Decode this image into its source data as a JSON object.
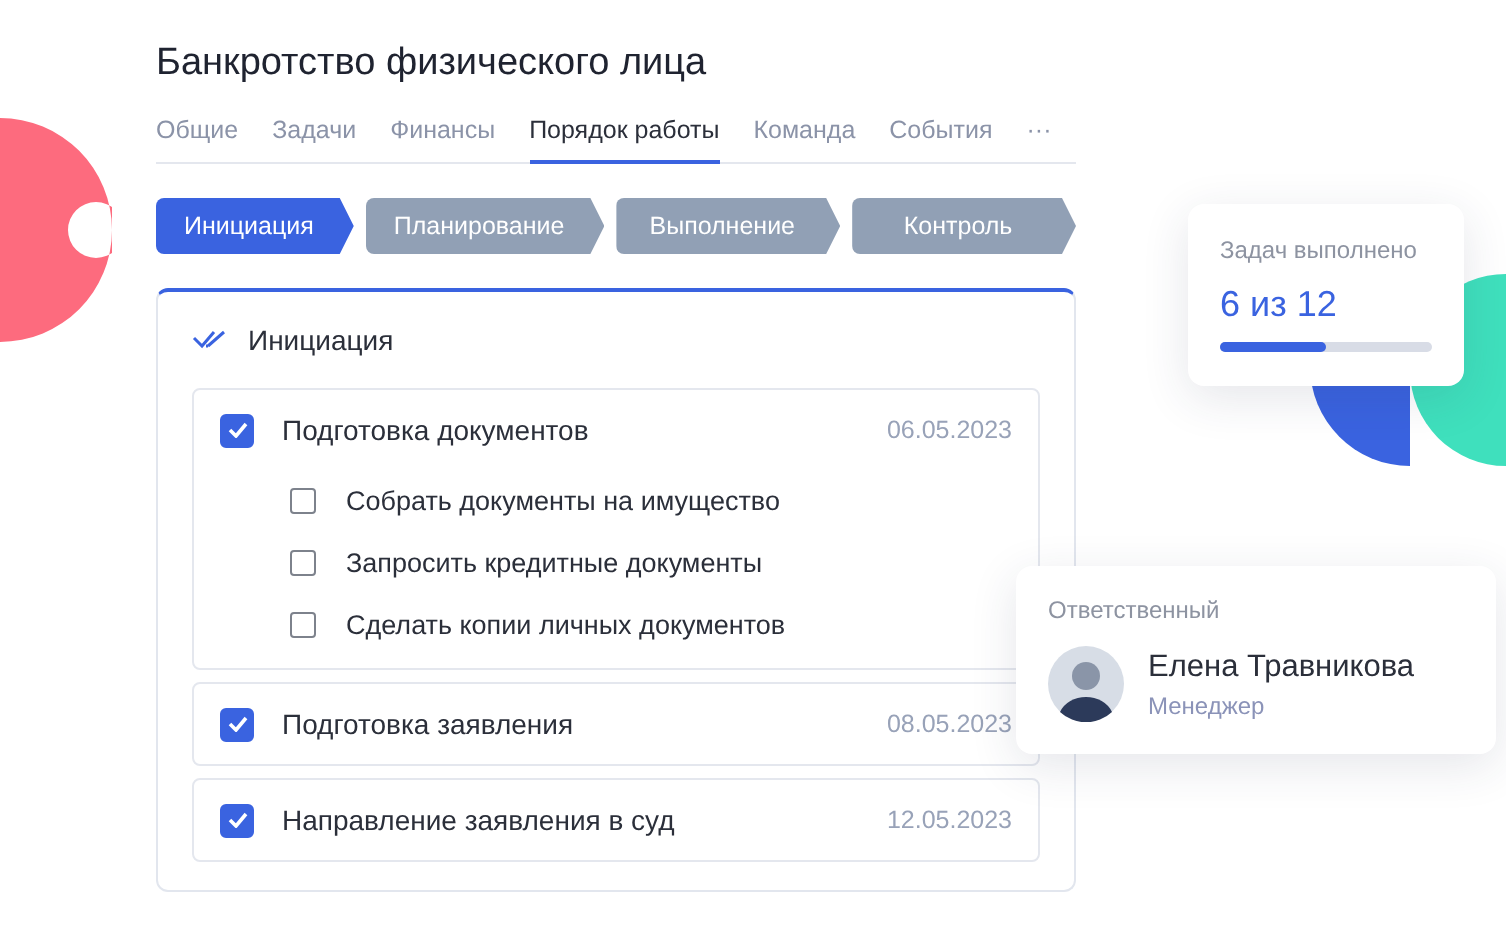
{
  "title": "Банкротство физического лица",
  "tabs": [
    {
      "label": "Общие",
      "selected": false
    },
    {
      "label": "Задачи",
      "selected": false
    },
    {
      "label": "Финансы",
      "selected": false
    },
    {
      "label": "Порядок работы",
      "selected": true
    },
    {
      "label": "Команда",
      "selected": false
    },
    {
      "label": "События",
      "selected": false
    },
    {
      "label": "···",
      "selected": false
    }
  ],
  "stages": [
    {
      "label": "Инициация",
      "selected": true
    },
    {
      "label": "Планирование",
      "selected": false
    },
    {
      "label": "Выполнение",
      "selected": false
    },
    {
      "label": "Контроль",
      "selected": false
    }
  ],
  "stage_panel": {
    "title": "Инициация",
    "tasks": [
      {
        "label": "Подготовка документов",
        "date": "06.05.2023",
        "checked": true,
        "children": [
          {
            "label": "Собрать документы на имущество",
            "checked": false
          },
          {
            "label": "Запросить кредитные документы",
            "checked": false
          },
          {
            "label": "Сделать копии личных документов",
            "checked": false
          }
        ]
      },
      {
        "label": "Подготовка заявления",
        "date": "08.05.2023",
        "checked": true
      },
      {
        "label": "Направление заявления в суд",
        "date": "12.05.2023",
        "checked": true
      }
    ]
  },
  "progress_card": {
    "label": "Задач выполнено",
    "value": "6 из 12",
    "level": 0.5
  },
  "responsible_card": {
    "label": "Ответственный",
    "name": "Елена Травникова",
    "role": "Менеджер"
  }
}
